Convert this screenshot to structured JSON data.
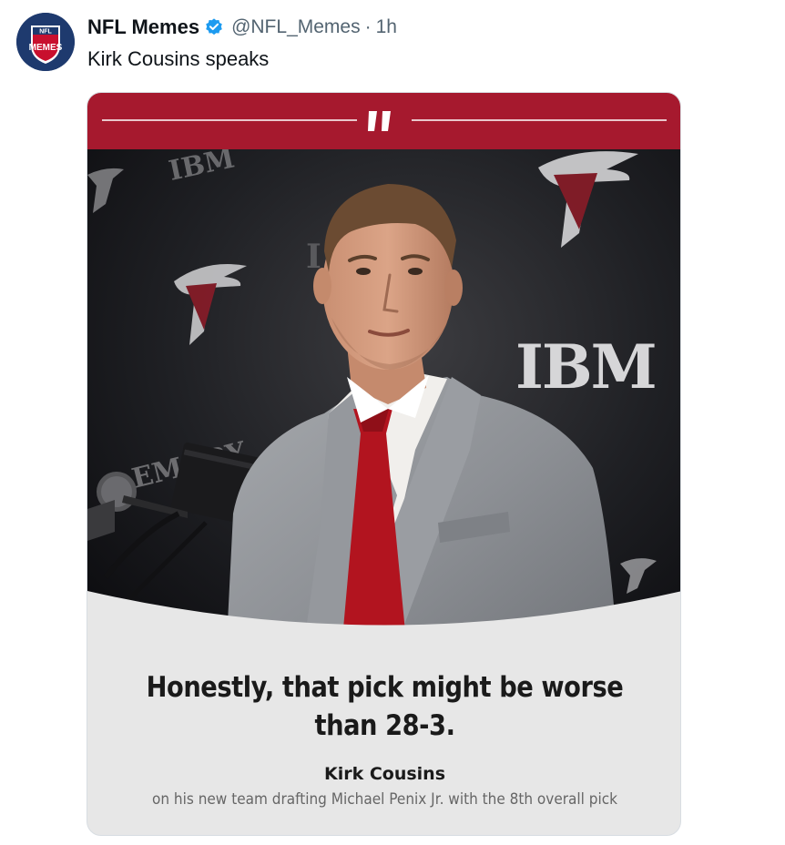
{
  "tweet": {
    "display_name": "NFL Memes",
    "handle": "@NFL_Memes",
    "separator": "·",
    "timestamp": "1h",
    "text": "Kirk Cousins speaks",
    "verified_icon": "verified-badge-icon",
    "avatar_text_top": "NFL",
    "avatar_text_main": "MEMES"
  },
  "media": {
    "quote_icon": "quote-marks-icon",
    "backdrop_logo_text": "IBM",
    "backdrop_sponsor_text": "EMORY",
    "quote": "Honestly, that pick might be worse than 28-3.",
    "speaker": "Kirk Cousins",
    "context": "on his new team drafting Michael Penix Jr. with the 8th overall pick"
  },
  "colors": {
    "brand_red": "#a6192e",
    "card_gray": "#e7e7e7",
    "verified_blue": "#1d9bf0",
    "text_primary": "#0f1419",
    "text_secondary": "#536471"
  }
}
